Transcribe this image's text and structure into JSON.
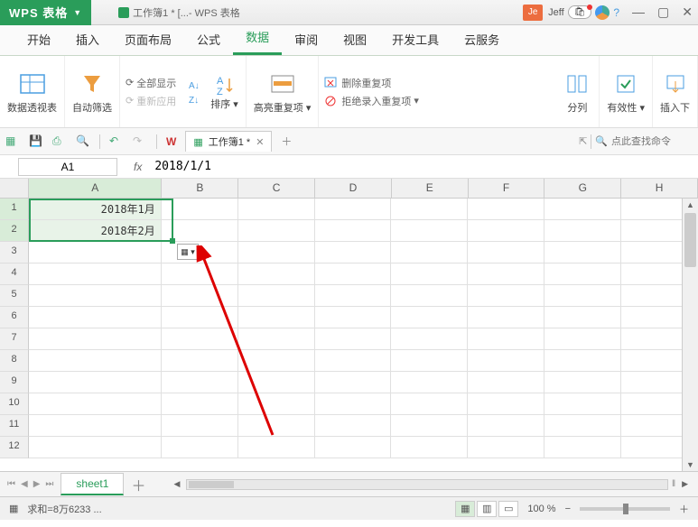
{
  "titlebar": {
    "app_name": "WPS 表格",
    "doc_title": "工作簿1 * [...- WPS 表格",
    "user_short": "Je",
    "user_name": "Jeff"
  },
  "menu": {
    "tabs": [
      "开始",
      "插入",
      "页面布局",
      "公式",
      "数据",
      "审阅",
      "视图",
      "开发工具",
      "云服务"
    ],
    "active_index": 4
  },
  "ribbon": {
    "pivot": "数据透视表",
    "autofilter": "自动筛选",
    "showall": "全部显示",
    "reapply": "重新应用",
    "sort": "排序",
    "highlight_dup": "高亮重复项",
    "remove_dup": "删除重复项",
    "reject_dup": "拒绝录入重复项",
    "text_to_col": "分列",
    "validity": "有效性",
    "insert_f": "插入下"
  },
  "quickbar": {
    "doc_tab": "工作簿1 *",
    "search_placeholder": "点此查找命令"
  },
  "namebox": {
    "ref": "A1",
    "formula": "2018/1/1"
  },
  "grid": {
    "columns": [
      "A",
      "B",
      "C",
      "D",
      "E",
      "F",
      "G",
      "H"
    ],
    "rows": [
      1,
      2,
      3,
      4,
      5,
      6,
      7,
      8,
      9,
      10,
      11,
      12
    ],
    "cells": {
      "A1": "2018年1月",
      "A2": "2018年2月"
    }
  },
  "sheet_tabs": {
    "active": "sheet1"
  },
  "statusbar": {
    "sum_text": "求和=8万6233 ...",
    "zoom": "100 %"
  }
}
